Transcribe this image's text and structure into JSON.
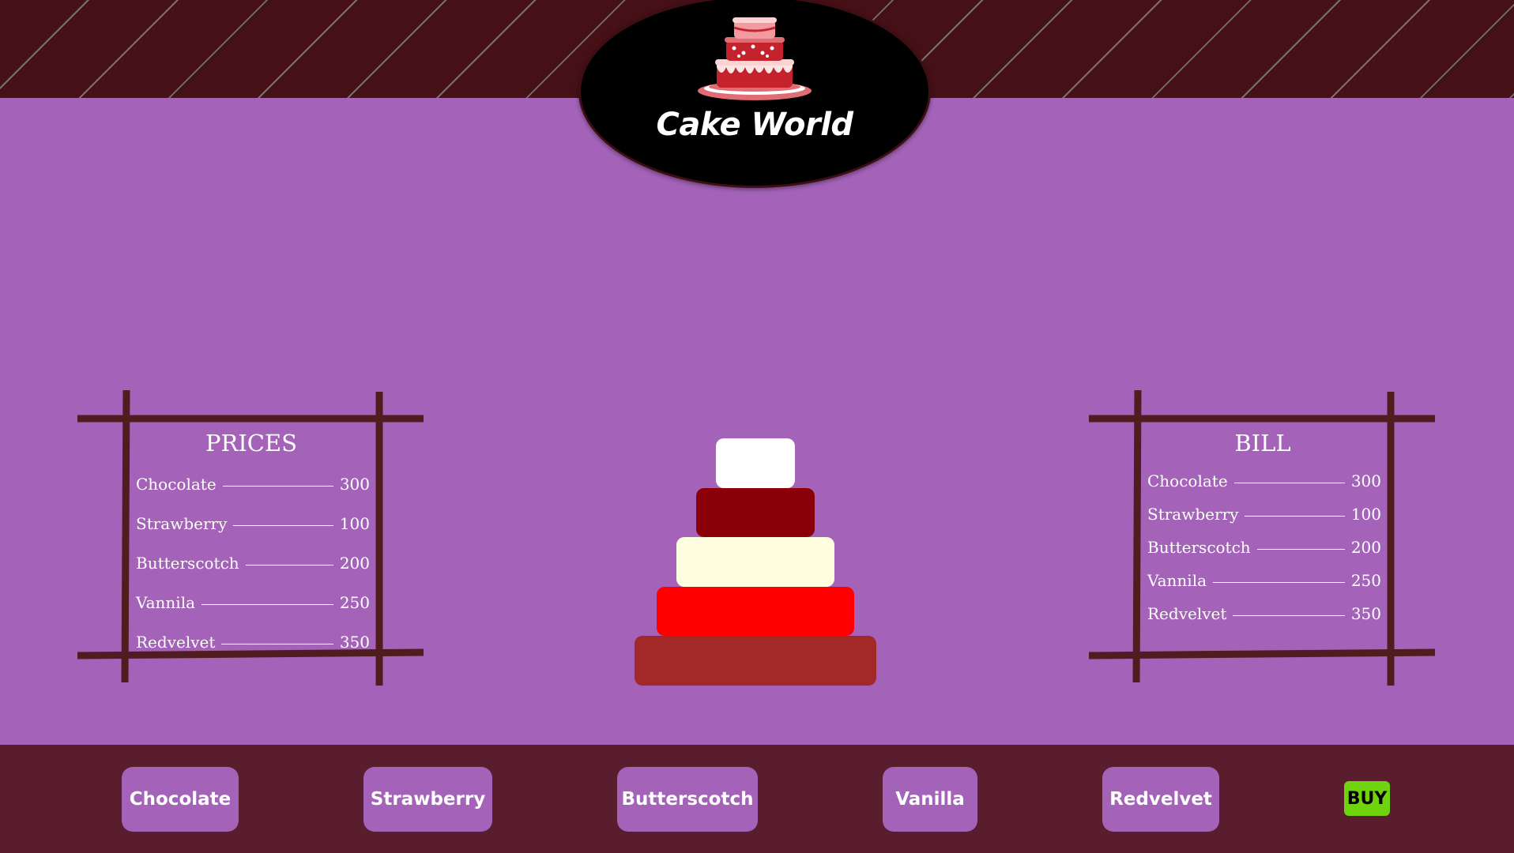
{
  "brand": {
    "title": "Cake World",
    "colors": {
      "background": "#a463b9",
      "banner": "#461116",
      "bottom_bar": "#591d2d",
      "buy": "#6fd40e"
    }
  },
  "prices_board": {
    "title": "PRICES",
    "items": [
      {
        "name": "Chocolate",
        "price": "300"
      },
      {
        "name": "Strawberry",
        "price": "100"
      },
      {
        "name": "Butterscotch",
        "price": "200"
      },
      {
        "name": "Vannila",
        "price": "250"
      },
      {
        "name": "Redvelvet",
        "price": "350"
      }
    ]
  },
  "bill_board": {
    "title": "BILL",
    "items": [
      {
        "name": "Chocolate",
        "price": "300"
      },
      {
        "name": "Strawberry",
        "price": "100"
      },
      {
        "name": "Butterscotch",
        "price": "200"
      },
      {
        "name": "Vannila",
        "price": "250"
      },
      {
        "name": "Redvelvet",
        "price": "350"
      }
    ]
  },
  "cake_tiers": [
    {
      "flavor": "Vanilla",
      "color": "#ffffff"
    },
    {
      "flavor": "Redvelvet",
      "color": "#8b0008"
    },
    {
      "flavor": "Butterscotch",
      "color": "#fffde0"
    },
    {
      "flavor": "Strawberry",
      "color": "#ff0000"
    },
    {
      "flavor": "Chocolate",
      "color": "#a32929"
    }
  ],
  "bottom_bar": {
    "buttons": [
      {
        "label": "Chocolate"
      },
      {
        "label": "Strawberry"
      },
      {
        "label": "Butterscotch"
      },
      {
        "label": "Vanilla"
      },
      {
        "label": "Redvelvet"
      }
    ],
    "buy_label": "BUY"
  }
}
